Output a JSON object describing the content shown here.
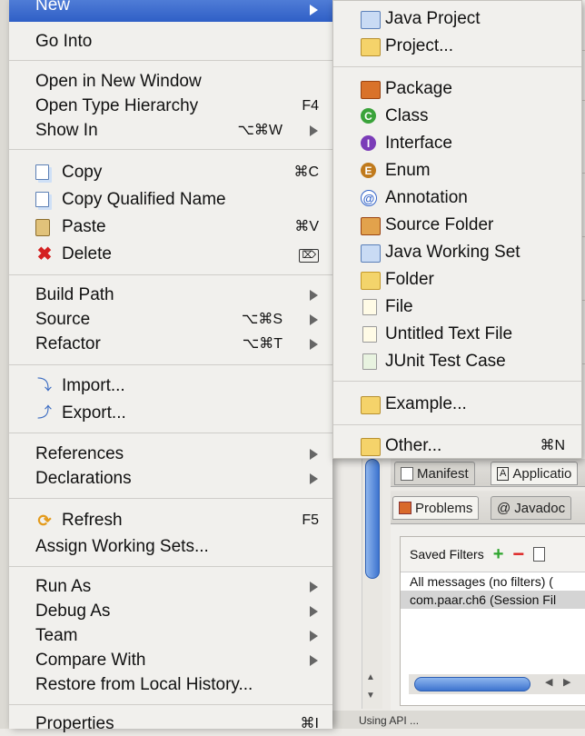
{
  "menu": {
    "new": "New",
    "go_into": "Go Into",
    "open_new_window": "Open in New Window",
    "open_type_hierarchy": "Open Type Hierarchy",
    "open_type_hierarchy_sc": "F4",
    "show_in": "Show In",
    "show_in_sc": "⌥⌘W",
    "copy": "Copy",
    "copy_sc": "⌘C",
    "copy_qualified": "Copy Qualified Name",
    "paste": "Paste",
    "paste_sc": "⌘V",
    "delete": "Delete",
    "delete_sc": "⌦",
    "build_path": "Build Path",
    "source": "Source",
    "source_sc": "⌥⌘S",
    "refactor": "Refactor",
    "refactor_sc": "⌥⌘T",
    "import": "Import...",
    "export": "Export...",
    "references": "References",
    "declarations": "Declarations",
    "refresh": "Refresh",
    "refresh_sc": "F5",
    "assign_ws": "Assign Working Sets...",
    "run_as": "Run As",
    "debug_as": "Debug As",
    "team": "Team",
    "compare_with": "Compare With",
    "restore_history": "Restore from Local History...",
    "properties": "Properties",
    "properties_sc": "⌘I"
  },
  "submenu": {
    "java_project": "Java Project",
    "project": "Project...",
    "package": "Package",
    "class": "Class",
    "interface": "Interface",
    "enum": "Enum",
    "annotation": "Annotation",
    "source_folder": "Source Folder",
    "java_working_set": "Java Working Set",
    "folder": "Folder",
    "file": "File",
    "untitled_text": "Untitled Text File",
    "junit": "JUnit Test Case",
    "example": "Example...",
    "other": "Other...",
    "other_sc": "⌘N"
  },
  "background": {
    "tab_manifest": "Manifest",
    "tab_application": "Applicatio",
    "tab_problems": "Problems",
    "tab_javadoc": "Javadoc",
    "saved_filters": "Saved Filters",
    "filter_all": "All messages (no filters) (",
    "filter_session": "com.paar.ch6 (Session Fil",
    "status": "Using API ..."
  },
  "colors": {
    "highlight": "#3a6bd0",
    "menu_bg": "#f1f0ed"
  }
}
